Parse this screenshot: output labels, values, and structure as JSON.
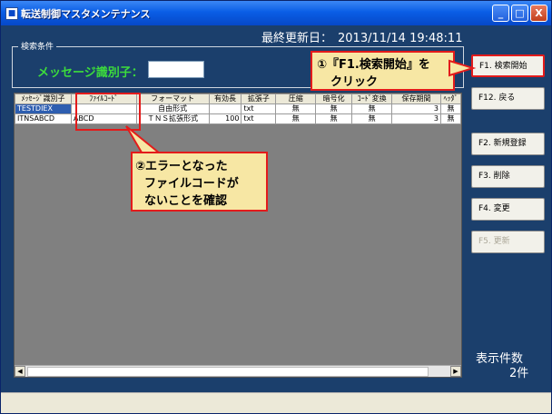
{
  "window": {
    "title": "転送制御マスタメンテナンス",
    "minimize": "_",
    "maximize": "□",
    "close": "X"
  },
  "last_update": {
    "label": "最終更新日：",
    "value": "2013/11/14 19:48:11"
  },
  "search": {
    "legend": "検索条件",
    "message_id_label": "メッセージ識別子：",
    "message_id_value": ""
  },
  "grid": {
    "columns": [
      "ﾒｯｾｰｼﾞ識別子",
      "ﾌｧｲﾙｺｰﾄﾞ",
      "フォーマット",
      "有効長",
      "拡張子",
      "圧縮",
      "暗号化",
      "ｺｰﾄﾞ変換",
      "保存期間",
      "ﾍｯﾀﾞ"
    ],
    "rows": [
      [
        "TESTDIEX",
        "",
        "自由形式",
        "",
        "txt",
        "無",
        "無",
        "無",
        "3",
        "無"
      ],
      [
        "ITNSABCD",
        "ABCD",
        "ＴＮＳ拡張形式",
        "100",
        "txt",
        "無",
        "無",
        "無",
        "3",
        "無"
      ]
    ]
  },
  "buttons": {
    "search": "F1. 検索開始",
    "back": "F12. 戻る",
    "new": "F2. 新規登録",
    "delete": "F3. 削除",
    "change": "F4. 変更",
    "update": "F5. 更新"
  },
  "callouts": {
    "step1_line1": "①『F1.検索開始』を",
    "step1_line2": "クリック",
    "step2_line1": "②エラーとなった",
    "step2_line2": "ファイルコードが",
    "step2_line3": "ないことを確認"
  },
  "display_count": {
    "label": "表示件数",
    "value": "2件"
  }
}
